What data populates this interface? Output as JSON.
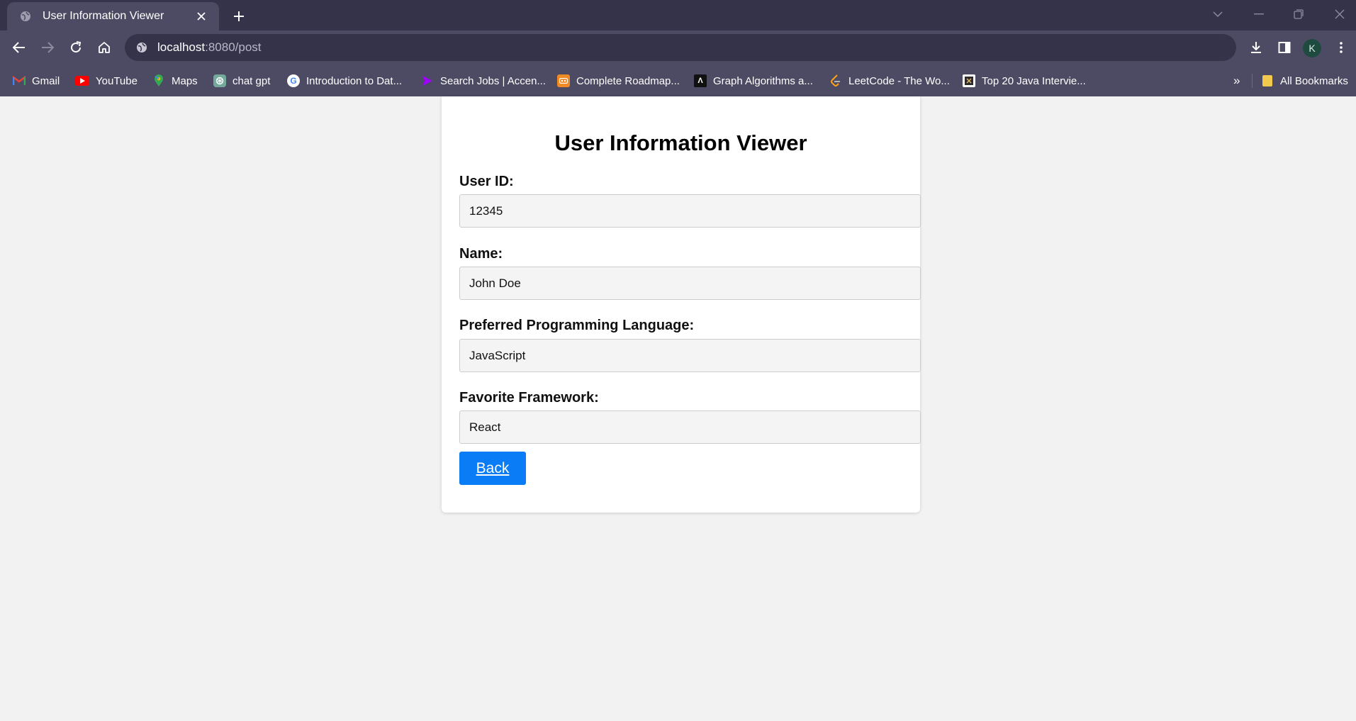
{
  "browser": {
    "tab": {
      "title": "User Information Viewer"
    },
    "address": {
      "host": "localhost",
      "path": ":8080/post"
    },
    "profile_initial": "K",
    "bookmarks": [
      {
        "label": "Gmail",
        "icon": "gmail-icon"
      },
      {
        "label": "YouTube",
        "icon": "youtube-icon"
      },
      {
        "label": "Maps",
        "icon": "maps-icon"
      },
      {
        "label": "chat gpt",
        "icon": "chatgpt-icon"
      },
      {
        "label": "Introduction to Dat...",
        "icon": "google-icon"
      },
      {
        "label": "Search Jobs | Accen...",
        "icon": "accenture-icon"
      },
      {
        "label": "Complete Roadmap...",
        "icon": "roadmap-icon"
      },
      {
        "label": "Graph Algorithms a...",
        "icon": "graph-icon"
      },
      {
        "label": "LeetCode - The Wo...",
        "icon": "leetcode-icon"
      },
      {
        "label": "Top 20 Java Intervie...",
        "icon": "java-icon"
      }
    ],
    "overflow_label": "»",
    "all_bookmarks_label": "All Bookmarks"
  },
  "page": {
    "title": "User Information Viewer",
    "fields": [
      {
        "label": "User ID:",
        "value": "12345"
      },
      {
        "label": "Name:",
        "value": "John Doe"
      },
      {
        "label": "Preferred Programming Language:",
        "value": "JavaScript"
      },
      {
        "label": "Favorite Framework:",
        "value": "React"
      }
    ],
    "back_label": "Back"
  },
  "colors": {
    "chrome_dark": "#35334a",
    "chrome_light": "#4d4a63",
    "page_bg": "#f2f2f2",
    "button_blue": "#0a7cf5"
  }
}
